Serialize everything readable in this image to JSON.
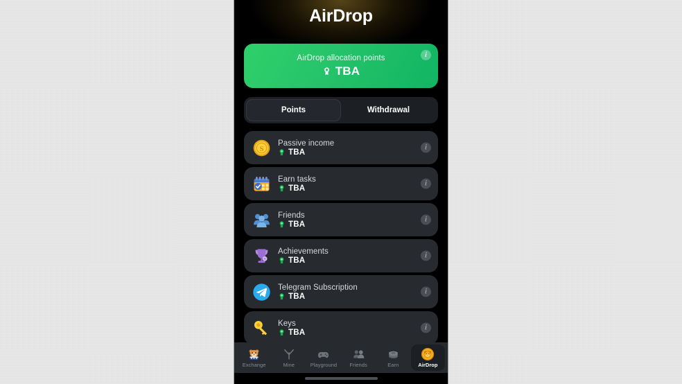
{
  "header": {
    "title": "AirDrop"
  },
  "allocation": {
    "label": "AirDrop allocation points",
    "value": "TBA",
    "medal_icon": "medal-icon",
    "info_icon": "info-icon",
    "info_glyph": "i",
    "gradient_from": "#2fd06a",
    "gradient_to": "#10b563"
  },
  "tabs": [
    {
      "label": "Points",
      "active": true,
      "name": "tab-points"
    },
    {
      "label": "Withdrawal",
      "active": false,
      "name": "tab-withdrawal"
    }
  ],
  "rewards": {
    "info_glyph": "i",
    "items": [
      {
        "title": "Passive income",
        "value": "TBA",
        "icon": "gold-coin-icon",
        "name": "reward-row-passive-income"
      },
      {
        "title": "Earn tasks",
        "value": "TBA",
        "icon": "calendar-tasks-icon",
        "name": "reward-row-earn-tasks"
      },
      {
        "title": "Friends",
        "value": "TBA",
        "icon": "friends-group-icon",
        "name": "reward-row-friends"
      },
      {
        "title": "Achievements",
        "value": "TBA",
        "icon": "trophy-icon",
        "name": "reward-row-achievements"
      },
      {
        "title": "Telegram Subscription",
        "value": "TBA",
        "icon": "telegram-icon",
        "name": "reward-row-telegram-subscription"
      },
      {
        "title": "Keys",
        "value": "TBA",
        "icon": "key-icon",
        "name": "reward-row-keys"
      }
    ]
  },
  "bottom_nav": [
    {
      "label": "Exchange",
      "icon": "hamster-icon",
      "active": false,
      "name": "nav-item-exchange"
    },
    {
      "label": "Mine",
      "icon": "pickaxe-icon",
      "active": false,
      "name": "nav-item-mine"
    },
    {
      "label": "Playground",
      "icon": "gamepad-icon",
      "active": false,
      "name": "nav-item-playground"
    },
    {
      "label": "Friends",
      "icon": "people-icon",
      "active": false,
      "name": "nav-item-friends"
    },
    {
      "label": "Earn",
      "icon": "coins-icon",
      "active": false,
      "name": "nav-item-earn"
    },
    {
      "label": "AirDrop",
      "icon": "coin-hamster-icon",
      "active": true,
      "name": "nav-item-airdrop"
    }
  ],
  "colors": {
    "phone_bg": "#000000",
    "card_bg": "#272a2f",
    "nav_bg": "#272a2f",
    "accent_green": "#27c46a",
    "accent_gold": "#f5a623",
    "desktop_bg": "#e9e9e9"
  }
}
